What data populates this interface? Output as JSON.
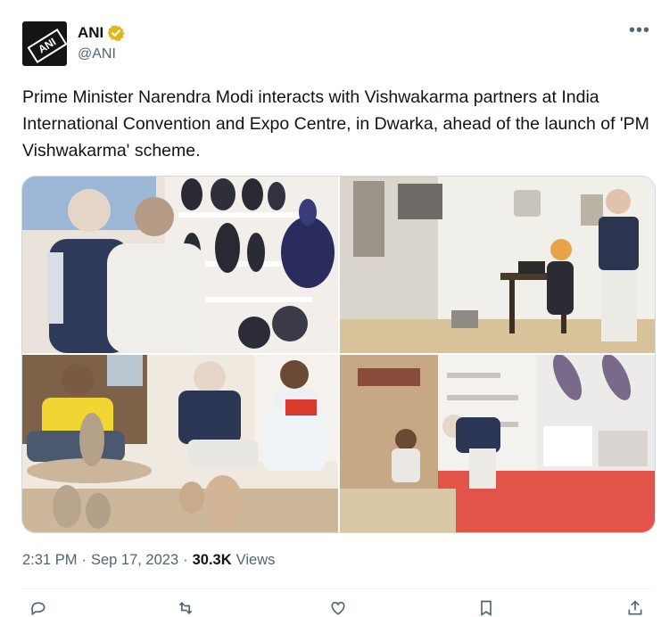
{
  "account": {
    "display_name": "ANI",
    "handle": "@ANI",
    "avatar_text": "ANI"
  },
  "tweet": {
    "text": "Prime Minister Narendra Modi interacts with Vishwakarma partners at India International Convention and Expo Centre, in Dwarka, ahead of the launch of 'PM Vishwakarma' scheme."
  },
  "meta": {
    "time": "2:31 PM",
    "separator": "·",
    "date": "Sep 17, 2023",
    "views_count": "30.3K",
    "views_label": "Views"
  },
  "icons": {
    "more": "more-options-icon",
    "verified": "verified-badge-icon",
    "actions": [
      "reply-icon",
      "repost-icon",
      "like-icon",
      "bookmark-icon",
      "share-icon"
    ]
  },
  "colors": {
    "verified_gold": "#e2b719",
    "secondary_text": "#536471",
    "border": "#cfd9de"
  }
}
